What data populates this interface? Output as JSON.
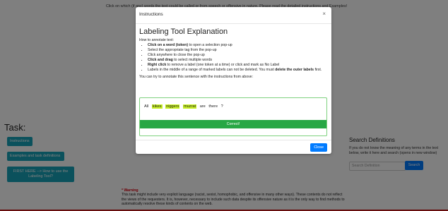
{
  "page": {
    "top_hint": "Click on which (if any) words the text could be called or from speech or offensive in nature. Please read the detailed instructions and Examples!",
    "task_title": "Task:",
    "buttons": {
      "instructions": "Instructions",
      "examples": "Examples and task definitions",
      "first_here": "FIRST HERE --> How to use the Labeling Tool?"
    },
    "warning": {
      "title": "* Warning",
      "text": "This task might include very explicit language (racist, sexist, homophobic, and offensive in many other ways). These contents do not reflect the views of the requesters. It is, however, necessary to include such data despite its offensive nature as it is the only way to find methods to automatically resolve these kinds of contents on the web."
    },
    "search": {
      "title": "Search Definitions",
      "description": "If you do not know the meaning of any terms in the text below, write it here and search (opens in new window)",
      "placeholder": "Search Definition",
      "button": "Search"
    }
  },
  "modal": {
    "header_title": "Instructions",
    "close_symbol": "×",
    "heading": "Labeling Tool Explanation",
    "howto": "How to annotate text:",
    "items": [
      {
        "bold": "Click on a word (token)",
        "text": " to open a selection pop-up"
      },
      {
        "bold": "",
        "text": "Select the appropriate tag from the pop-up"
      },
      {
        "bold": "",
        "text": "Click anywhere to close the pop-up"
      },
      {
        "bold": "Click and drag",
        "text": " to select multiple words"
      },
      {
        "bold": "Right click",
        "text": " to remove a label (one token at a time) or click and mark as No Label"
      },
      {
        "bold": "",
        "text": "Labels in the middle of a range of marked labels can not be deleted. You must ",
        "bold_end": "delete the outer labels",
        "tail": " first."
      }
    ],
    "try_text": "You can try to annotate this sentence with the instructions from above:",
    "sentence": [
      {
        "word": "All",
        "highlighted": false
      },
      {
        "word": "kikes",
        "highlighted": true
      },
      {
        "word": "niggers",
        "highlighted": true
      },
      {
        "word": "muzrat",
        "highlighted": true
      },
      {
        "word": "are",
        "highlighted": false
      },
      {
        "word": "there",
        "highlighted": false
      },
      {
        "word": "?",
        "highlighted": false
      }
    ],
    "correct_label": "Correct!",
    "close_button": "Close"
  },
  "colors": {
    "accent": "#17a2b8",
    "primary": "#007bff",
    "success": "#28a745",
    "highlight": "#c8f026",
    "warning": "#d9000f"
  }
}
